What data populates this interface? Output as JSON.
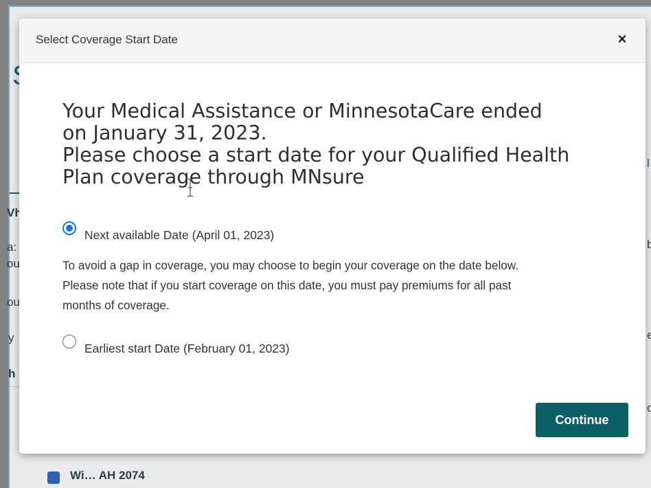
{
  "dialog": {
    "title": "Select Coverage Start Date",
    "close_symbol": "×",
    "headline": [
      "Your Medical Assistance or MinnesotaCare ended",
      "on January 31, 2023.",
      "Please choose a start date for your Qualified Health",
      "Plan coverage through MNsure"
    ],
    "options": [
      {
        "label": "Next available Date (April 01, 2023)",
        "checked": true
      },
      {
        "label": "Earliest start Date (February 01, 2023)",
        "checked": false
      }
    ],
    "info_lines": [
      "To avoid a gap in coverage, you may choose to begin your coverage on the date below.",
      "Please note that if you start coverage on this date, you must pay premiums for all past",
      "months of coverage."
    ],
    "continue_label": "Continue"
  },
  "background": {
    "heading_letter": "S",
    "left_fragments": [
      "Vh",
      "a:",
      "ou",
      "ou",
      "y",
      "h"
    ],
    "right_fragments": [
      "l",
      "b",
      "e",
      "o"
    ],
    "bottom_text": "Wi… AH 2074"
  },
  "colors": {
    "accent": "#0b5f66",
    "radio": "#1b73e8"
  }
}
